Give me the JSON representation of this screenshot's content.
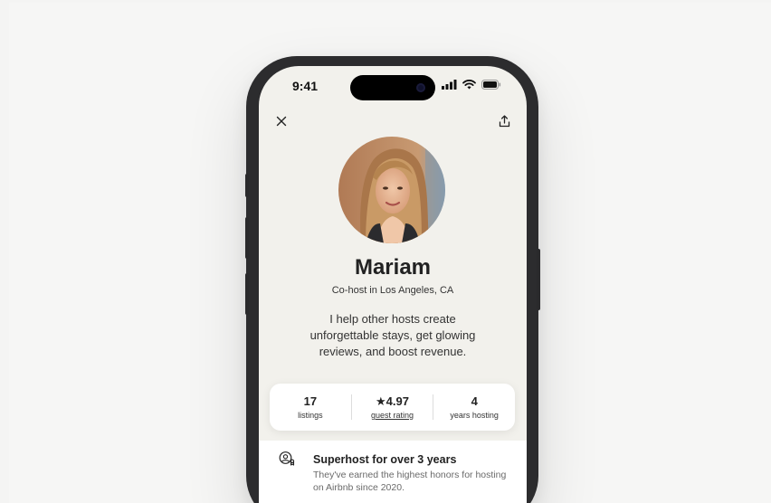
{
  "status_bar": {
    "time": "9:41"
  },
  "profile": {
    "name": "Mariam",
    "subtitle": "Co-host in Los Angeles, CA",
    "bio": "I help other hosts create unforgettable stays, get glowing reviews, and boost revenue."
  },
  "stats": [
    {
      "value": "17",
      "label": "listings"
    },
    {
      "value": "★4.97",
      "label": "guest rating"
    },
    {
      "value": "4",
      "label": "years hosting"
    }
  ],
  "feature": {
    "title": "Superhost for over 3 years",
    "description": "They've earned the highest honors for hosting on Airbnb since 2020."
  },
  "icons": {
    "close": "close-icon",
    "share": "share-icon",
    "signal": "cellular-signal-icon",
    "wifi": "wifi-icon",
    "battery": "battery-icon",
    "superhost": "superhost-badge-icon"
  },
  "colors": {
    "screen_background": "#f2f1ec",
    "text_primary": "#222222",
    "text_secondary": "#6a6a6a"
  }
}
